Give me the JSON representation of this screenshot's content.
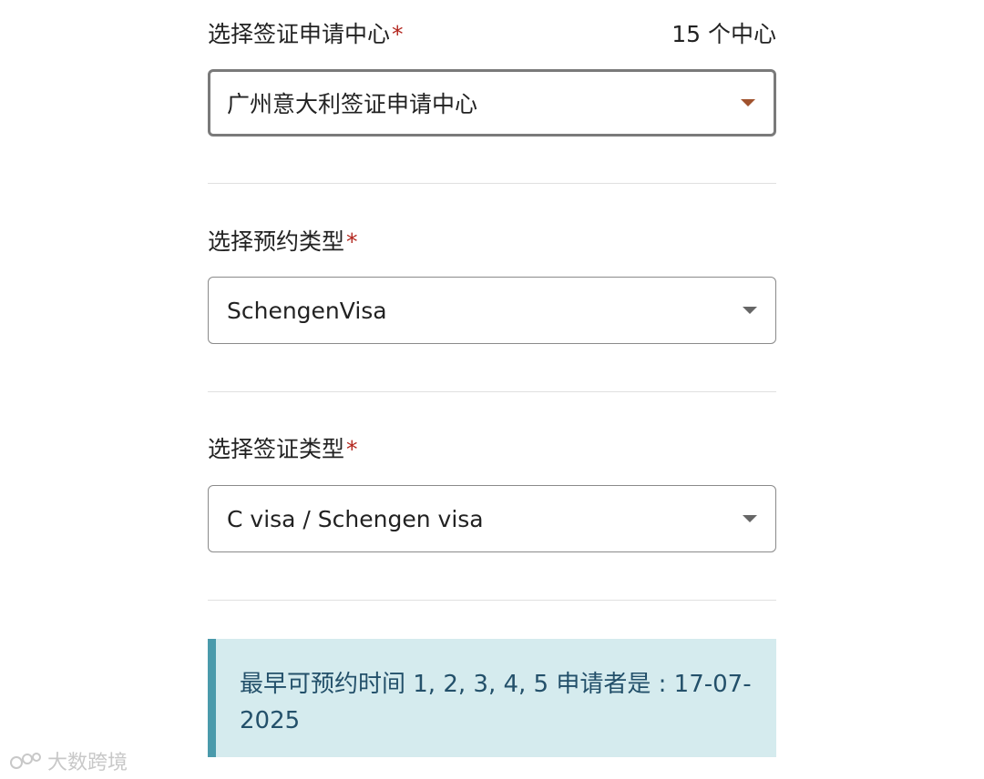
{
  "form": {
    "center": {
      "label": "选择签证申请中心",
      "required_mark": "*",
      "count_text": "15 个中心",
      "selected": "广州意大利签证申请中心",
      "accent_color": "#a0522d"
    },
    "appointment_type": {
      "label": "选择预约类型",
      "required_mark": "*",
      "selected": "SchengenVisa"
    },
    "visa_type": {
      "label": "选择签证类型",
      "required_mark": "*",
      "selected": "C visa / Schengen visa"
    }
  },
  "notice": {
    "text": "最早可预约时间 1, 2, 3, 4, 5 申请者是 : 17-07-2025",
    "background": "#d5ebee",
    "border_color": "#4a9aab"
  },
  "watermark": {
    "text": "大数跨境"
  }
}
